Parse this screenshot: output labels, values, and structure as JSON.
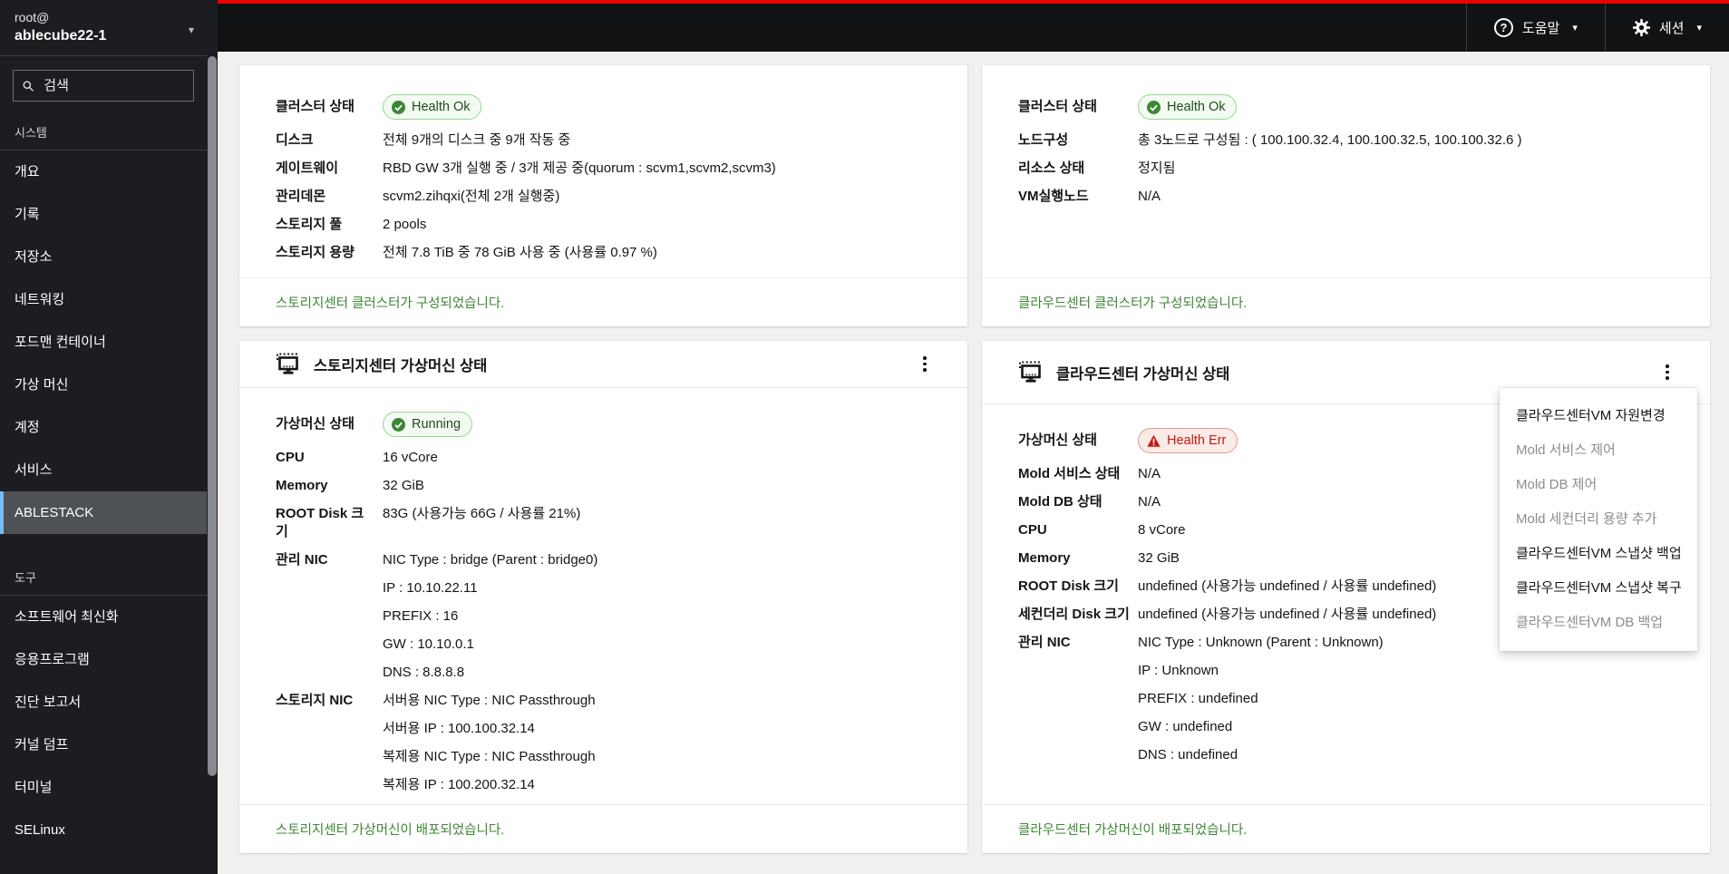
{
  "colors": {
    "top_strip_red": "#ee0000",
    "success_green": "#3e8635",
    "danger_red": "#c9190b",
    "nav_selected_accent": "#73bcf7",
    "badge_ok_bg": "#f3faf2",
    "badge_err_bg": "#faeae8"
  },
  "masthead": {
    "help": "도움말",
    "session": "세션"
  },
  "sidebar": {
    "user": "root@",
    "host": "ablecube22-1",
    "search_placeholder": "검색",
    "selected": "ABLESTACK",
    "sections": [
      {
        "title": "시스템",
        "items": [
          "개요",
          "기록",
          "저장소",
          "네트워킹",
          "포드맨 컨테이너",
          "가상 머신",
          "계정",
          "서비스",
          "ABLESTACK"
        ]
      },
      {
        "title": "도구",
        "items": [
          "소프트웨어 최신화",
          "응용프로그램",
          "진단 보고서",
          "커널 덤프",
          "터미널",
          "SELinux"
        ]
      }
    ]
  },
  "cards": {
    "storage_cluster": {
      "rows": [
        {
          "label": "클러스터 상태",
          "badge": {
            "text": "Health Ok",
            "type": "ok"
          }
        },
        {
          "label": "디스크",
          "value": "전체 9개의 디스크 중 9개 작동 중"
        },
        {
          "label": "게이트웨이",
          "value": "RBD GW 3개 실행 중 / 3개 제공 중(quorum : scvm1,scvm2,scvm3)"
        },
        {
          "label": "관리데몬",
          "value": "scvm2.zihqxi(전체 2개 실행중)"
        },
        {
          "label": "스토리지 풀",
          "value": "2 pools"
        },
        {
          "label": "스토리지 용량",
          "value": "전체 7.8 TiB 중 78 GiB 사용 중 (사용률 0.97 %)"
        }
      ],
      "footer": "스토리지센터 클러스터가 구성되었습니다."
    },
    "cloud_cluster": {
      "rows": [
        {
          "label": "클러스터 상태",
          "badge": {
            "text": "Health Ok",
            "type": "ok"
          }
        },
        {
          "label": "노드구성",
          "value": "총 3노드로 구성됨 : ( 100.100.32.4, 100.100.32.5, 100.100.32.6 )"
        },
        {
          "label": "리소스 상태",
          "value": "정지됨"
        },
        {
          "label": "VM실행노드",
          "value": "N/A"
        }
      ],
      "footer": "클라우드센터 클러스터가 구성되었습니다."
    },
    "storage_vm": {
      "title": "스토리지센터 가상머신 상태",
      "rows": [
        {
          "label": "가상머신 상태",
          "badge": {
            "text": "Running",
            "type": "ok"
          }
        },
        {
          "label": "CPU",
          "value": "16 vCore"
        },
        {
          "label": "Memory",
          "value": "32 GiB"
        },
        {
          "label": "ROOT Disk 크기",
          "value": "83G (사용가능 66G / 사용률 21%)"
        },
        {
          "label": "관리 NIC",
          "lines": [
            "NIC Type : bridge (Parent : bridge0)",
            "IP : 10.10.22.11",
            "PREFIX : 16",
            "GW : 10.10.0.1",
            "DNS : 8.8.8.8"
          ]
        },
        {
          "label": "스토리지 NIC",
          "lines": [
            "서버용 NIC Type : NIC Passthrough",
            "서버용 IP : 100.100.32.14",
            "복제용 NIC Type : NIC Passthrough",
            "복제용 IP : 100.200.32.14"
          ]
        }
      ],
      "footer": "스토리지센터 가상머신이 배포되었습니다."
    },
    "cloud_vm": {
      "title": "클라우드센터 가상머신 상태",
      "rows": [
        {
          "label": "가상머신 상태",
          "badge": {
            "text": "Health Err",
            "type": "err"
          }
        },
        {
          "label": "Mold 서비스 상태",
          "value": "N/A"
        },
        {
          "label": "Mold DB 상태",
          "value": "N/A"
        },
        {
          "label": "CPU",
          "value": "8 vCore"
        },
        {
          "label": "Memory",
          "value": "32 GiB"
        },
        {
          "label": "ROOT Disk 크기",
          "value": "undefined (사용가능 undefined / 사용률 undefined)"
        },
        {
          "label": "세컨더리 Disk 크기",
          "value": "undefined (사용가능 undefined / 사용률 undefined)"
        },
        {
          "label": "관리 NIC",
          "lines": [
            "NIC Type : Unknown (Parent : Unknown)",
            "IP : Unknown",
            "PREFIX : undefined",
            "GW : undefined",
            "DNS : undefined"
          ]
        }
      ],
      "footer": "클라우드센터 가상머신이 배포되었습니다."
    }
  },
  "menu": {
    "items": [
      {
        "label": "클라우드센터VM 자원변경",
        "enabled": true
      },
      {
        "label": "Mold 서비스 제어",
        "enabled": false
      },
      {
        "label": "Mold DB 제어",
        "enabled": false
      },
      {
        "label": "Mold 세컨더리 용량 추가",
        "enabled": false
      },
      {
        "label": "클라우드센터VM 스냅샷 백업",
        "enabled": true
      },
      {
        "label": "클라우드센터VM 스냅샷 복구",
        "enabled": true
      },
      {
        "label": "클라우드센터VM DB 백업",
        "enabled": false
      }
    ]
  }
}
